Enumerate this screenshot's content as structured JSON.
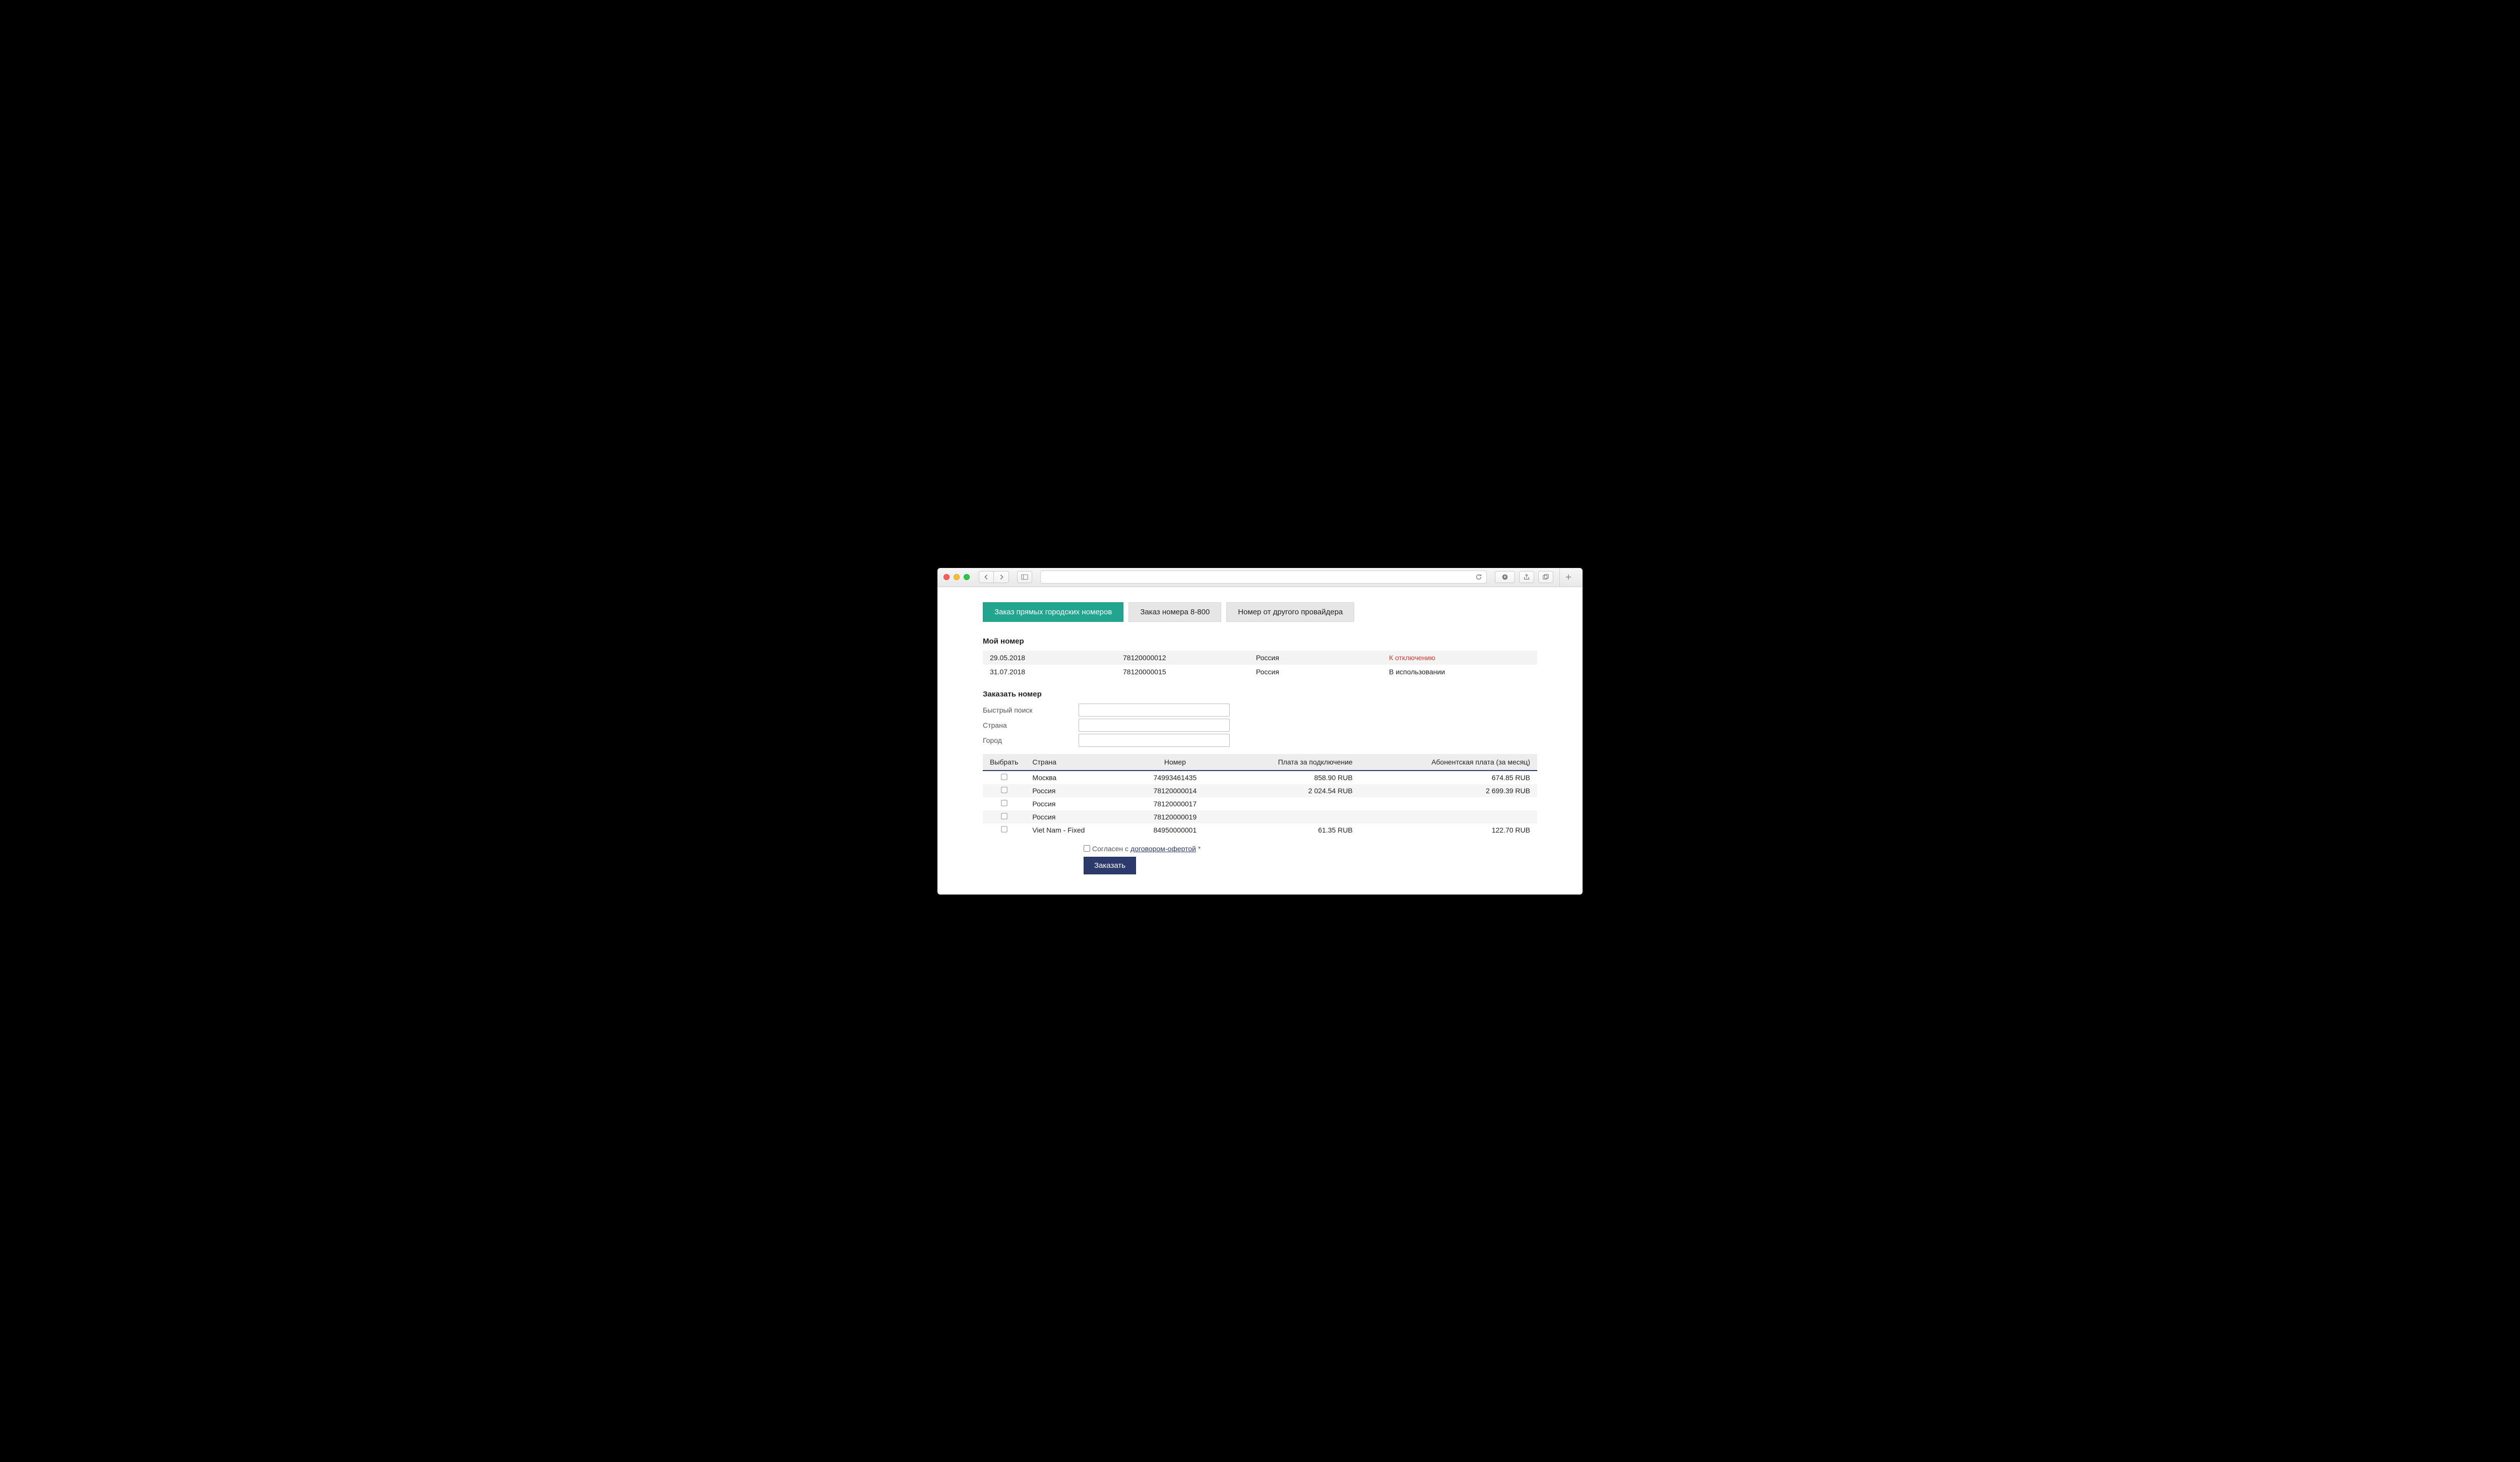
{
  "tabs": {
    "city": "Заказ прямых городских номеров",
    "tollfree": "Заказ номера 8-800",
    "other": "Номер от другого провайдера"
  },
  "sections": {
    "my_number": "Мой номер",
    "order_number": "Заказать номер"
  },
  "my_numbers": [
    {
      "date": "29.05.2018",
      "number": "78120000012",
      "country": "Россия",
      "status": "К отключению",
      "status_class": "status-red"
    },
    {
      "date": "31.07.2018",
      "number": "78120000015",
      "country": "Россия",
      "status": "В использовании",
      "status_class": ""
    }
  ],
  "form": {
    "quick_search_label": "Быстрый поиск",
    "country_label": "Страна",
    "city_label": "Город",
    "quick_search_value": "",
    "country_value": "",
    "city_value": ""
  },
  "avail_headers": {
    "select": "Выбрать",
    "country": "Страна",
    "number": "Номер",
    "connect_fee": "Плата за подключение",
    "monthly_fee": "Абонентская плата (за месяц)"
  },
  "avail_rows": [
    {
      "country": "Москва",
      "number": "74993461435",
      "connect": "858.90 RUB",
      "monthly": "674.85 RUB"
    },
    {
      "country": "Россия",
      "number": "78120000014",
      "connect": "2 024.54 RUB",
      "monthly": "2 699.39 RUB"
    },
    {
      "country": "Россия",
      "number": "78120000017",
      "connect": "",
      "monthly": ""
    },
    {
      "country": "Россия",
      "number": "78120000019",
      "connect": "",
      "monthly": ""
    },
    {
      "country": "Viet Nam - Fixed",
      "number": "84950000001",
      "connect": "61.35 RUB",
      "monthly": "122.70 RUB"
    }
  ],
  "agree": {
    "prefix": "Согласен с ",
    "link": "договором-офертой",
    "suffix": "*"
  },
  "order_button": "Заказать"
}
